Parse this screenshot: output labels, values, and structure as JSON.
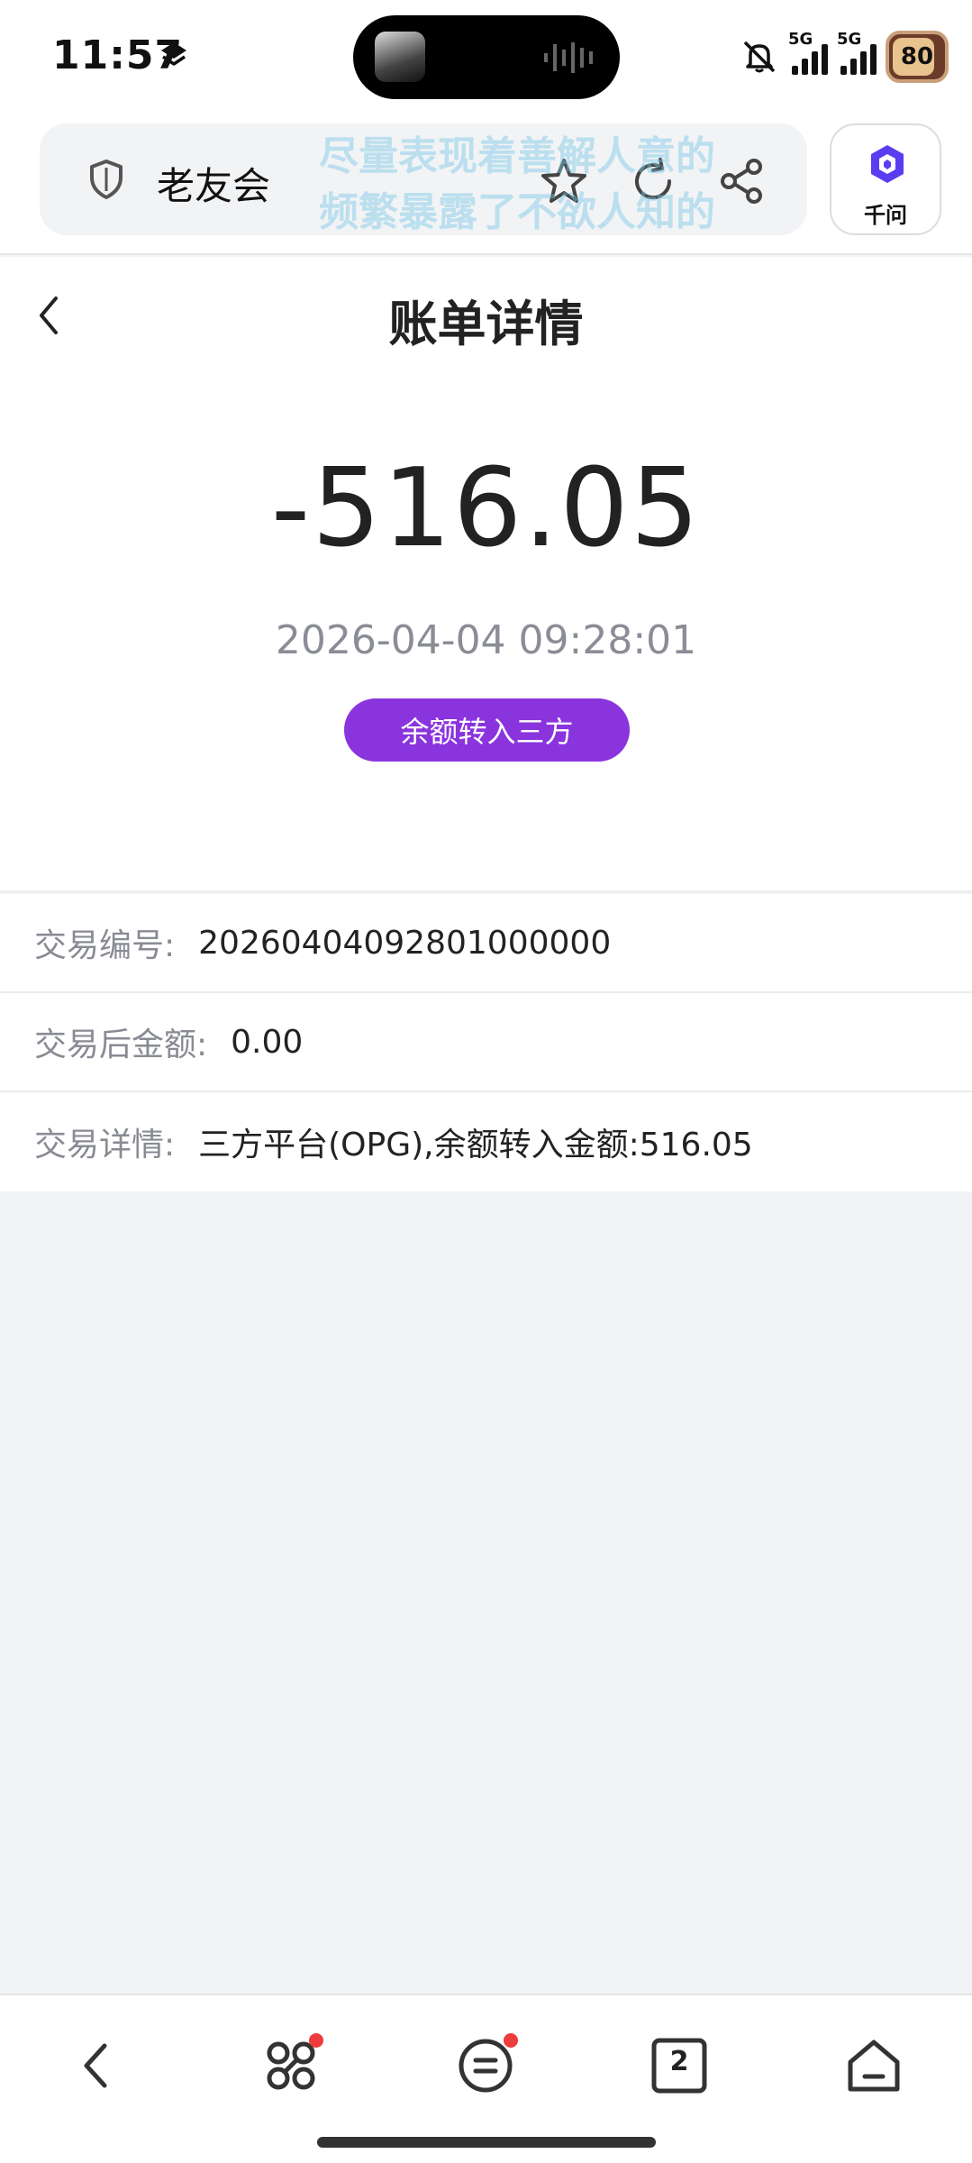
{
  "status_bar": {
    "time": "11:57",
    "signal_1_label": "5G",
    "signal_2_label": "5G",
    "battery": "80"
  },
  "browser": {
    "site_title": "老友会",
    "overlay_text_line1": "尽量表现着善解人意的",
    "overlay_text_line2": "频繁暴露了不欲人知的",
    "assistant_label": "千问"
  },
  "header": {
    "title": "账单详情"
  },
  "summary": {
    "amount": "-516.05",
    "datetime": "2026-04-04 09:28:01",
    "type_badge": "余额转入三方"
  },
  "details": {
    "rows": [
      {
        "label": "交易编号:",
        "value": "20260404092801000000"
      },
      {
        "label": "交易后金额:",
        "value": "0.00"
      },
      {
        "label": "交易详情:",
        "value": "三方平台(OPG),余额转入金额:516.05"
      }
    ]
  },
  "bottom_nav": {
    "tab_count": "2"
  },
  "colors": {
    "accent_purple": "#8a34de",
    "notification_red": "#ee3b3b",
    "page_background": "#f2f3f7"
  }
}
